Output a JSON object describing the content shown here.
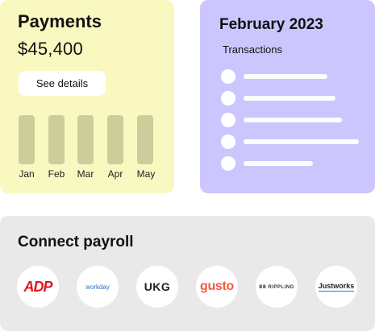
{
  "payments": {
    "title": "Payments",
    "amount": "$45,400",
    "details_button": "See details",
    "months": [
      "Jan",
      "Feb",
      "Mar",
      "Apr",
      "May"
    ]
  },
  "transactions": {
    "month": "February 2023",
    "label": "Transactions"
  },
  "payroll": {
    "title": "Connect payroll",
    "providers": [
      "ADP",
      "workday",
      "UKG",
      "gusto",
      "RIPPLING",
      "Justworks"
    ]
  },
  "colors": {
    "payments_bg": "#f9f8c1",
    "transactions_bg": "#cbc6fe",
    "payroll_bg": "#e9e9e9",
    "bar": "#cdcc9b"
  }
}
